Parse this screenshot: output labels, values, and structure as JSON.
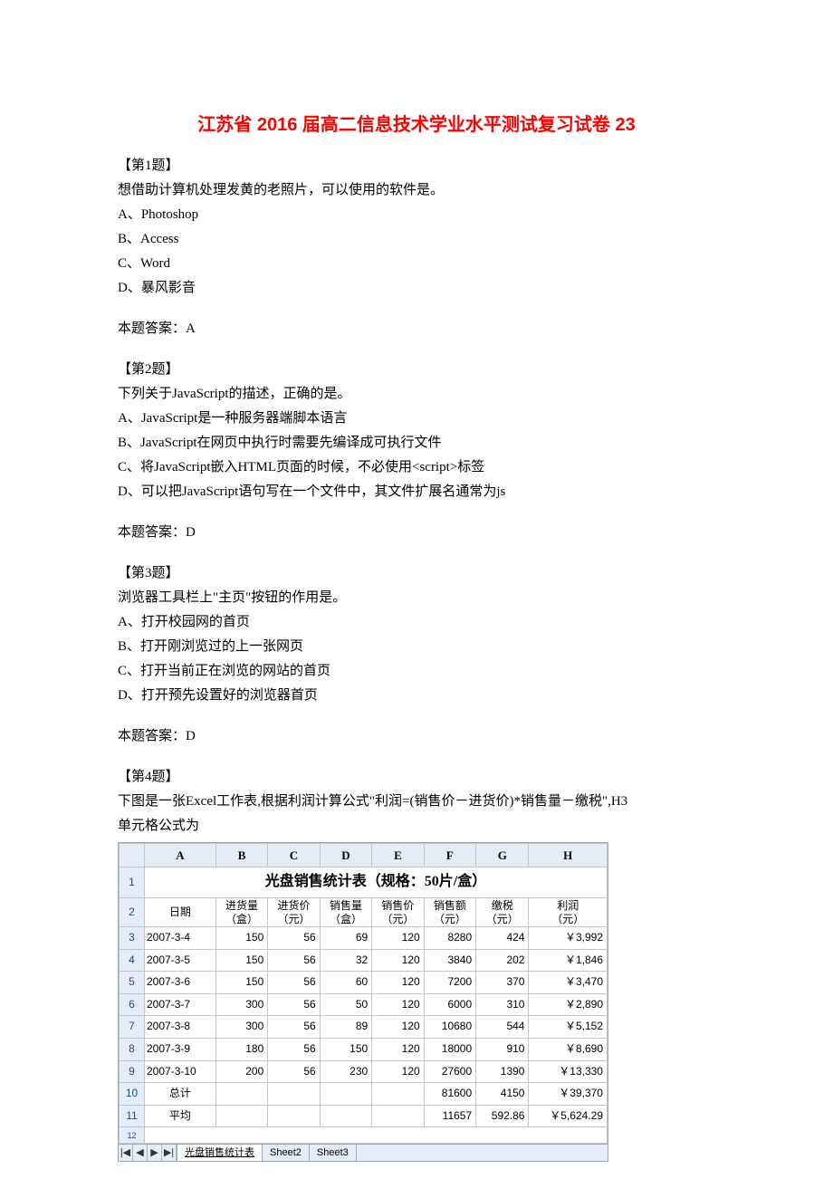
{
  "title": "江苏省 2016 届高二信息技术学业水平测试复习试卷 23",
  "q1": {
    "label": "【第1题】",
    "stem": "想借助计算机处理发黄的老照片，可以使用的软件是。",
    "optA": "A、Photoshop",
    "optB": "B、Access",
    "optC": "C、Word",
    "optD": "D、暴风影音",
    "ans": "本题答案：A"
  },
  "q2": {
    "label": "【第2题】",
    "stem": "下列关于JavaScript的描述，正确的是。",
    "optA": "A、JavaScript是一种服务器端脚本语言",
    "optB": "B、JavaScript在网页中执行时需要先编译成可执行文件",
    "optC": "C、将JavaScript嵌入HTML页面的时候，不必使用<script>标签",
    "optD": "D、可以把JavaScript语句写在一个文件中，其文件扩展名通常为js",
    "ans": "本题答案：D"
  },
  "q3": {
    "label": "【第3题】",
    "stem": "浏览器工具栏上\"主页\"按钮的作用是。",
    "optA": "A、打开校园网的首页",
    "optB": "B、打开刚浏览过的上一张网页",
    "optC": "C、打开当前正在浏览的网站的首页",
    "optD": "D、打开预先设置好的浏览器首页",
    "ans": "本题答案：D"
  },
  "q4": {
    "label": "【第4题】",
    "stem1": "下图是一张Excel工作表,根据利润计算公式\"利润=(销售价－进货价)*销售量－缴税\",H3",
    "stem2": "单元格公式为"
  },
  "excel": {
    "cols": [
      "A",
      "B",
      "C",
      "D",
      "E",
      "F",
      "G",
      "H"
    ],
    "mergedTitle": "光盘销售统计表（规格：50片/盒）",
    "headers": [
      {
        "l1": "日期",
        "l2": ""
      },
      {
        "l1": "进货量",
        "l2": "（盒）"
      },
      {
        "l1": "进货价",
        "l2": "（元）"
      },
      {
        "l1": "销售量",
        "l2": "（盒）"
      },
      {
        "l1": "销售价",
        "l2": "（元）"
      },
      {
        "l1": "销售额",
        "l2": "（元）"
      },
      {
        "l1": "缴税",
        "l2": "（元）"
      },
      {
        "l1": "利润",
        "l2": "（元）"
      }
    ],
    "rows": [
      {
        "n": "3",
        "d": "2007-3-4",
        "b": "150",
        "c": "56",
        "q": "69",
        "p": "120",
        "s": "8280",
        "t": "424",
        "pr": "￥3,992"
      },
      {
        "n": "4",
        "d": "2007-3-5",
        "b": "150",
        "c": "56",
        "q": "32",
        "p": "120",
        "s": "3840",
        "t": "202",
        "pr": "￥1,846"
      },
      {
        "n": "5",
        "d": "2007-3-6",
        "b": "150",
        "c": "56",
        "q": "60",
        "p": "120",
        "s": "7200",
        "t": "370",
        "pr": "￥3,470"
      },
      {
        "n": "6",
        "d": "2007-3-7",
        "b": "300",
        "c": "56",
        "q": "50",
        "p": "120",
        "s": "6000",
        "t": "310",
        "pr": "￥2,890"
      },
      {
        "n": "7",
        "d": "2007-3-8",
        "b": "300",
        "c": "56",
        "q": "89",
        "p": "120",
        "s": "10680",
        "t": "544",
        "pr": "￥5,152"
      },
      {
        "n": "8",
        "d": "2007-3-9",
        "b": "180",
        "c": "56",
        "q": "150",
        "p": "120",
        "s": "18000",
        "t": "910",
        "pr": "￥8,690"
      },
      {
        "n": "9",
        "d": "2007-3-10",
        "b": "200",
        "c": "56",
        "q": "230",
        "p": "120",
        "s": "27600",
        "t": "1390",
        "pr": "￥13,330"
      }
    ],
    "totalRow": {
      "n": "10",
      "label": "总计",
      "s": "81600",
      "t": "4150",
      "pr": "￥39,370"
    },
    "avgRow": {
      "n": "11",
      "label": "平均",
      "s": "11657",
      "t": "592.86",
      "pr": "￥5,624.29"
    },
    "extraRow": "12",
    "tabs": {
      "active": "光盘销售统计表",
      "t2": "Sheet2",
      "t3": "Sheet3"
    },
    "nav": {
      "first": "|◀",
      "prev": "◀",
      "next": "▶",
      "last": "▶|"
    }
  }
}
